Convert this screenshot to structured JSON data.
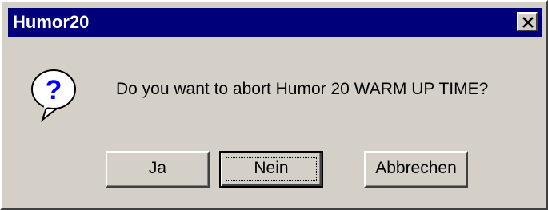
{
  "dialog": {
    "title": "Humor20",
    "message": "Do you want to abort Humor 20 WARM UP TIME?",
    "icon": "question-icon",
    "close_icon": "close-icon"
  },
  "buttons": {
    "yes_label": "Ja",
    "no_label": "Nein",
    "cancel_label": "Abbrechen",
    "default": "no"
  },
  "colors": {
    "titlebar": "#00007b",
    "face": "#d4d0c8",
    "icon_blue": "#0000ff"
  }
}
